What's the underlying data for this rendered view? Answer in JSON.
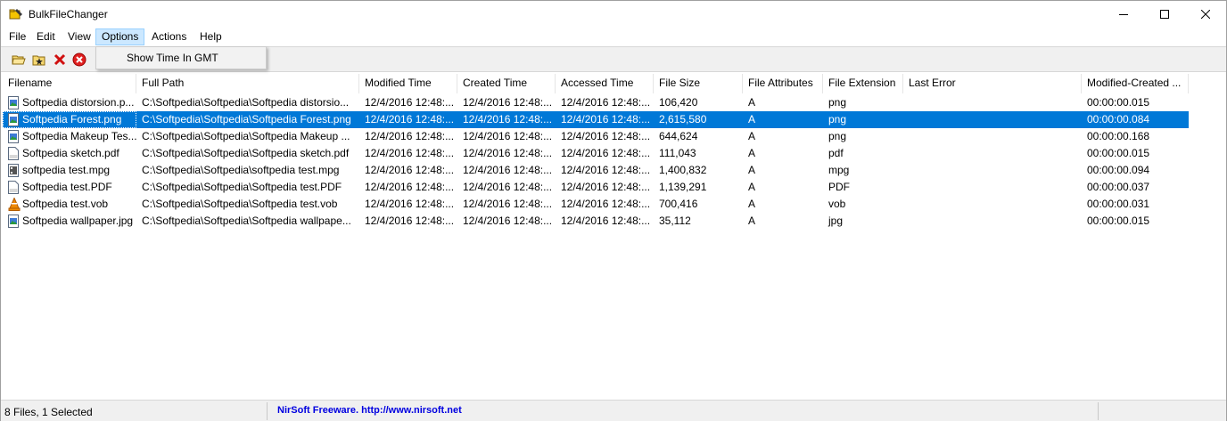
{
  "window": {
    "title": "BulkFileChanger"
  },
  "menu": [
    {
      "label": "File"
    },
    {
      "label": "Edit"
    },
    {
      "label": "View"
    },
    {
      "label": "Options"
    },
    {
      "label": "Actions"
    },
    {
      "label": "Help"
    }
  ],
  "toolbar": {
    "icons": [
      "open-folder-icon",
      "add-files-icon",
      "remove-icon",
      "clear-all-icon"
    ]
  },
  "dropdown": {
    "item": "Show Time In GMT"
  },
  "columns": [
    "Filename",
    "Full Path",
    "Modified Time",
    "Created Time",
    "Accessed Time",
    "File Size",
    "File Attributes",
    "File Extension",
    "Last Error",
    "Modified-Created ..."
  ],
  "rows": [
    {
      "name": "Softpedia distorsion.p...",
      "path": "C:\\Softpedia\\Softpedia\\Softpedia distorsio...",
      "modified": "12/4/2016 12:48:...",
      "created": "12/4/2016 12:48:...",
      "accessed": "12/4/2016 12:48:...",
      "size": "106,420",
      "attr": "A",
      "ext": "png",
      "error": "",
      "diff": "00:00:00.015",
      "icon": "image-file-icon"
    },
    {
      "name": "Softpedia Forest.png",
      "path": "C:\\Softpedia\\Softpedia\\Softpedia Forest.png",
      "modified": "12/4/2016 12:48:...",
      "created": "12/4/2016 12:48:...",
      "accessed": "12/4/2016 12:48:...",
      "size": "2,615,580",
      "attr": "A",
      "ext": "png",
      "error": "",
      "diff": "00:00:00.084",
      "icon": "image-file-icon"
    },
    {
      "name": "Softpedia Makeup Tes...",
      "path": "C:\\Softpedia\\Softpedia\\Softpedia Makeup ...",
      "modified": "12/4/2016 12:48:...",
      "created": "12/4/2016 12:48:...",
      "accessed": "12/4/2016 12:48:...",
      "size": "644,624",
      "attr": "A",
      "ext": "png",
      "error": "",
      "diff": "00:00:00.168",
      "icon": "image-file-icon"
    },
    {
      "name": "Softpedia sketch.pdf",
      "path": "C:\\Softpedia\\Softpedia\\Softpedia sketch.pdf",
      "modified": "12/4/2016 12:48:...",
      "created": "12/4/2016 12:48:...",
      "accessed": "12/4/2016 12:48:...",
      "size": "111,043",
      "attr": "A",
      "ext": "pdf",
      "error": "",
      "diff": "00:00:00.015",
      "icon": "pdf-file-icon"
    },
    {
      "name": "softpedia test.mpg",
      "path": "C:\\Softpedia\\Softpedia\\softpedia test.mpg",
      "modified": "12/4/2016 12:48:...",
      "created": "12/4/2016 12:48:...",
      "accessed": "12/4/2016 12:48:...",
      "size": "1,400,832",
      "attr": "A",
      "ext": "mpg",
      "error": "",
      "diff": "00:00:00.094",
      "icon": "video-file-icon"
    },
    {
      "name": "Softpedia test.PDF",
      "path": "C:\\Softpedia\\Softpedia\\Softpedia test.PDF",
      "modified": "12/4/2016 12:48:...",
      "created": "12/4/2016 12:48:...",
      "accessed": "12/4/2016 12:48:...",
      "size": "1,139,291",
      "attr": "A",
      "ext": "PDF",
      "error": "",
      "diff": "00:00:00.037",
      "icon": "pdf-file-icon"
    },
    {
      "name": "Softpedia test.vob",
      "path": "C:\\Softpedia\\Softpedia\\Softpedia test.vob",
      "modified": "12/4/2016 12:48:...",
      "created": "12/4/2016 12:48:...",
      "accessed": "12/4/2016 12:48:...",
      "size": "700,416",
      "attr": "A",
      "ext": "vob",
      "error": "",
      "diff": "00:00:00.031",
      "icon": "vlc-file-icon"
    },
    {
      "name": "Softpedia wallpaper.jpg",
      "path": "C:\\Softpedia\\Softpedia\\Softpedia wallpape...",
      "modified": "12/4/2016 12:48:...",
      "created": "12/4/2016 12:48:...",
      "accessed": "12/4/2016 12:48:...",
      "size": "35,112",
      "attr": "A",
      "ext": "jpg",
      "error": "",
      "diff": "00:00:00.015",
      "icon": "image-file-icon"
    }
  ],
  "selected_row": 1,
  "status": {
    "count": "8 Files, 1 Selected",
    "link": "NirSoft Freeware.  http://www.nirsoft.net"
  },
  "colors": {
    "selection": "#0078d7",
    "menu_highlight": "#cce8ff",
    "link": "#0000e0"
  }
}
